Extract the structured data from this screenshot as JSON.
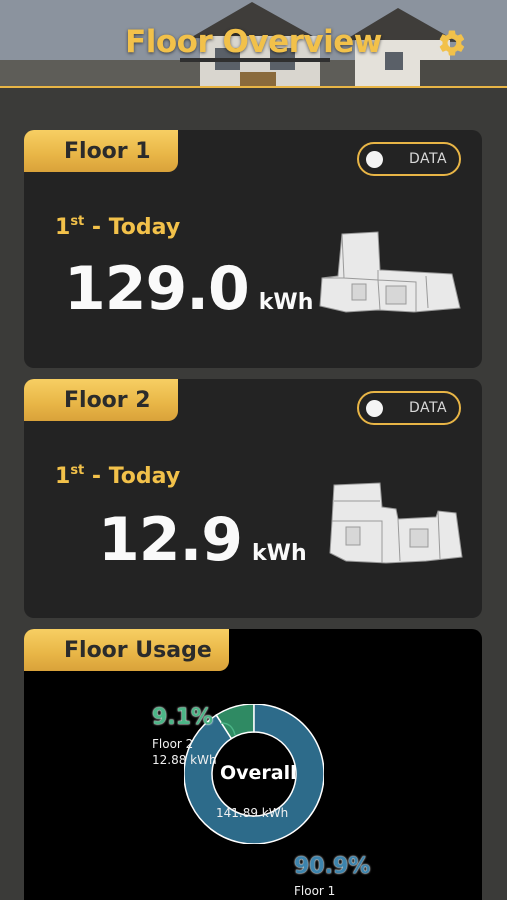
{
  "header": {
    "title": "Floor Overview",
    "settings_icon": "gear-icon"
  },
  "floors": [
    {
      "name": "Floor 1",
      "toggle_label": "DATA",
      "day_ordinal": "1",
      "day_suffix": "st",
      "day_text": " - Today",
      "value": "129.0",
      "unit": "kWh"
    },
    {
      "name": "Floor 2",
      "toggle_label": "DATA",
      "day_ordinal": "1",
      "day_suffix": "st",
      "day_text": " - Today",
      "value": "12.9",
      "unit": "kWh"
    }
  ],
  "usage": {
    "title": "Floor Usage",
    "center_label": "Overall",
    "center_total": "141.89 kWh",
    "floor2_pct": "9.1%",
    "floor2_name": "Floor 2",
    "floor2_kwh": "12.88 kWh",
    "floor1_pct": "90.9%",
    "floor1_name": "Floor 1"
  },
  "chart_data": {
    "type": "pie",
    "title": "",
    "categories": [
      "Floor 1",
      "Floor 2"
    ],
    "values": [
      129.01,
      12.88
    ],
    "percentages": [
      90.9,
      9.1
    ],
    "colors": [
      "#2d6b8a",
      "#2f8a63"
    ],
    "donut": true
  },
  "colors": {
    "accent": "#e8b546",
    "card_bg": "#232323",
    "floor1_color": "#2d6b8a",
    "floor2_color": "#2f8a63"
  }
}
